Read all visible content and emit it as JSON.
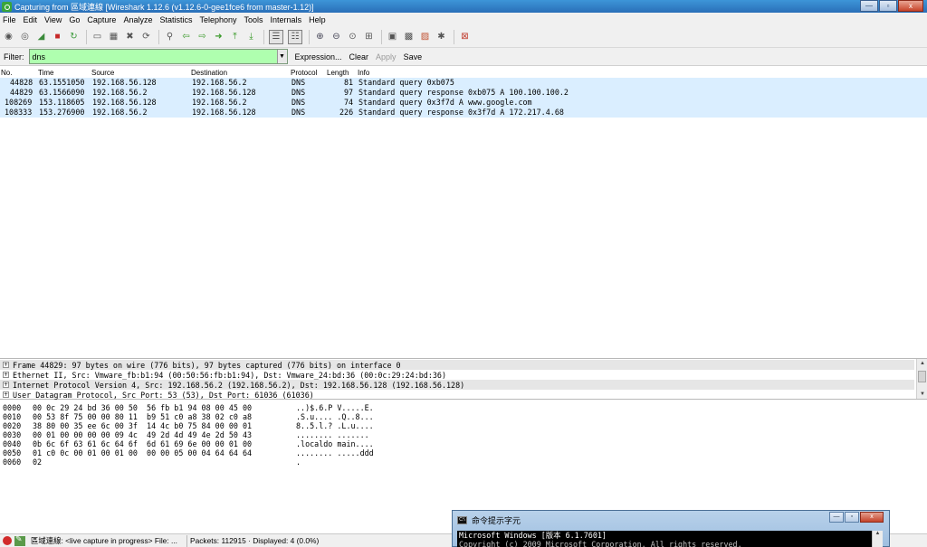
{
  "window": {
    "title": "Capturing from 區域連線   [Wireshark 1.12.6  (v1.12.6-0-gee1fce6 from master-1.12)]",
    "buttons": [
      "—",
      "▫",
      "x"
    ]
  },
  "menu": [
    "File",
    "Edit",
    "View",
    "Go",
    "Capture",
    "Analyze",
    "Statistics",
    "Telephony",
    "Tools",
    "Internals",
    "Help"
  ],
  "toolbar": {
    "icons": [
      "interfaces-icon",
      "options-icon",
      "start-capture-icon",
      "stop-capture-icon",
      "restart-capture-icon",
      "sep",
      "open-file-icon",
      "save-file-icon",
      "close-file-icon",
      "reload-icon",
      "sep",
      "find-packet-icon",
      "go-back-icon",
      "go-forward-icon",
      "go-to-packet-icon",
      "go-first-icon",
      "go-last-icon",
      "sep",
      "colorize-icon",
      "auto-scroll-icon",
      "sep",
      "zoom-in-icon",
      "zoom-out-icon",
      "zoom-normal-icon",
      "resize-columns-icon",
      "sep",
      "capture-filters-icon",
      "display-filters-icon",
      "coloring-rules-icon",
      "preferences-icon",
      "sep",
      "help-icon"
    ]
  },
  "filter": {
    "label": "Filter:",
    "value": "dns",
    "actions": [
      "Expression...",
      "Clear",
      "Apply",
      "Save"
    ]
  },
  "packet_columns": [
    "No.",
    "Time",
    "Source",
    "Destination",
    "Protocol",
    "Length",
    "Info"
  ],
  "packets": [
    {
      "no": "44828",
      "time": "63.1551050",
      "src": "192.168.56.128",
      "dst": "192.168.56.2",
      "proto": "DNS",
      "len": "81",
      "info": "Standard query 0xb075"
    },
    {
      "no": "44829",
      "time": "63.1566090",
      "src": "192.168.56.2",
      "dst": "192.168.56.128",
      "proto": "DNS",
      "len": "97",
      "info": "Standard query response 0xb075  A 100.100.100.2"
    },
    {
      "no": "108269",
      "time": "153.118605",
      "src": "192.168.56.128",
      "dst": "192.168.56.2",
      "proto": "DNS",
      "len": "74",
      "info": "Standard query 0x3f7d  A www.google.com"
    },
    {
      "no": "108333",
      "time": "153.276900",
      "src": "192.168.56.2",
      "dst": "192.168.56.128",
      "proto": "DNS",
      "len": "226",
      "info": "Standard query response 0x3f7d  A 172.217.4.68"
    }
  ],
  "details": [
    "Frame 44829: 97 bytes on wire (776 bits), 97 bytes captured (776 bits) on interface 0",
    "Ethernet II, Src: Vmware_fb:b1:94 (00:50:56:fb:b1:94), Dst: Vmware_24:bd:36 (00:0c:29:24:bd:36)",
    "Internet Protocol Version 4, Src: 192.168.56.2 (192.168.56.2), Dst: 192.168.56.128 (192.168.56.128)",
    "User Datagram Protocol, Src Port: 53 (53), Dst Port: 61036 (61036)"
  ],
  "hex": [
    {
      "off": "0000",
      "hex": "00 0c 29 24 bd 36 00 50  56 fb b1 94 08 00 45 00",
      "ascii": "..)$.6.P V.....E."
    },
    {
      "off": "0010",
      "hex": "00 53 8f 75 00 00 80 11  b9 51 c0 a8 38 02 c0 a8",
      "ascii": ".S.u.... .Q..8..."
    },
    {
      "off": "0020",
      "hex": "38 80 00 35 ee 6c 00 3f  14 4c b0 75 84 00 00 01",
      "ascii": "8..5.l.? .L.u...."
    },
    {
      "off": "0030",
      "hex": "00 01 00 00 00 00 09 4c  49 2d 4d 49 4e 2d 50 43",
      "ascii": "........ ......."
    },
    {
      "off": "0040",
      "hex": "0b 6c 6f 63 61 6c 64 6f  6d 61 69 6e 00 00 01 00",
      "ascii": ".localdo main...."
    },
    {
      "off": "0050",
      "hex": "01 c0 0c 00 01 00 01 00  00 00 05 00 04 64 64 64",
      "ascii": "........ .....ddd"
    },
    {
      "off": "0060",
      "hex": "02",
      "ascii": "."
    }
  ],
  "status": {
    "interface": "區域連線: <live capture in progress> File: ...",
    "packets": "Packets: 112915 · Displayed: 4 (0.0%)"
  },
  "cmd": {
    "title": "命令提示字元",
    "lines": [
      "Microsoft Windows [版本 6.1.7601]",
      "Copyright (c) 2009 Microsoft Corporation.  All rights reserved."
    ]
  }
}
